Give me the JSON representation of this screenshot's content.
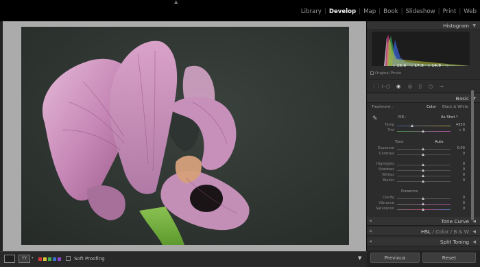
{
  "modules": [
    "Library",
    "Develop",
    "Map",
    "Book",
    "Slideshow",
    "Print",
    "Web"
  ],
  "active_module": "Develop",
  "panels": {
    "histogram": {
      "title": "Histogram",
      "r_label": "R",
      "r_value": "15.6",
      "g_label": "G",
      "g_value": "17.5",
      "b_label": "B",
      "b_value": "14.9",
      "unit": "%",
      "original_photo": "Original Photo"
    },
    "basic": {
      "title": "Basic",
      "treatment_label": "Treatment :",
      "color": "Color",
      "black_white": "Black & White",
      "wb_label": "WB :",
      "wb_value": "As Shot",
      "temp_label": "Temp",
      "temp_value": "4950",
      "tint_label": "Tint",
      "tint_value": "+ 8",
      "tone_label": "Tone",
      "auto": "Auto",
      "exposure_label": "Exposure",
      "exposure_value": "0.00",
      "contrast_label": "Contrast",
      "contrast_value": "0",
      "highlights_label": "Highlights",
      "highlights_value": "0",
      "shadows_label": "Shadows",
      "shadows_value": "0",
      "whites_label": "Whites",
      "whites_value": "0",
      "blacks_label": "Blacks",
      "blacks_value": "0",
      "presence_label": "Presence",
      "clarity_label": "Clarity",
      "clarity_value": "0",
      "vibrance_label": "Vibrance",
      "vibrance_value": "0",
      "saturation_label": "Saturation",
      "saturation_value": "0"
    },
    "tone_curve": "Tone Curve",
    "hsl": "HSL",
    "hsl_sep1": "/",
    "hsl_color": "Color",
    "hsl_sep2": "/",
    "hsl_bw": "B & W",
    "split_toning": "Split Toning"
  },
  "buttons": {
    "previous": "Previous",
    "reset": "Reset"
  },
  "toolbar": {
    "view_label": "YY",
    "soft_proofing": "Soft Proofing"
  },
  "colors": {
    "panel_bg": "#2c2c2c",
    "workspace_bg": "#ababab",
    "photo_bg": "#333a36",
    "flower": "#c58bb5"
  }
}
